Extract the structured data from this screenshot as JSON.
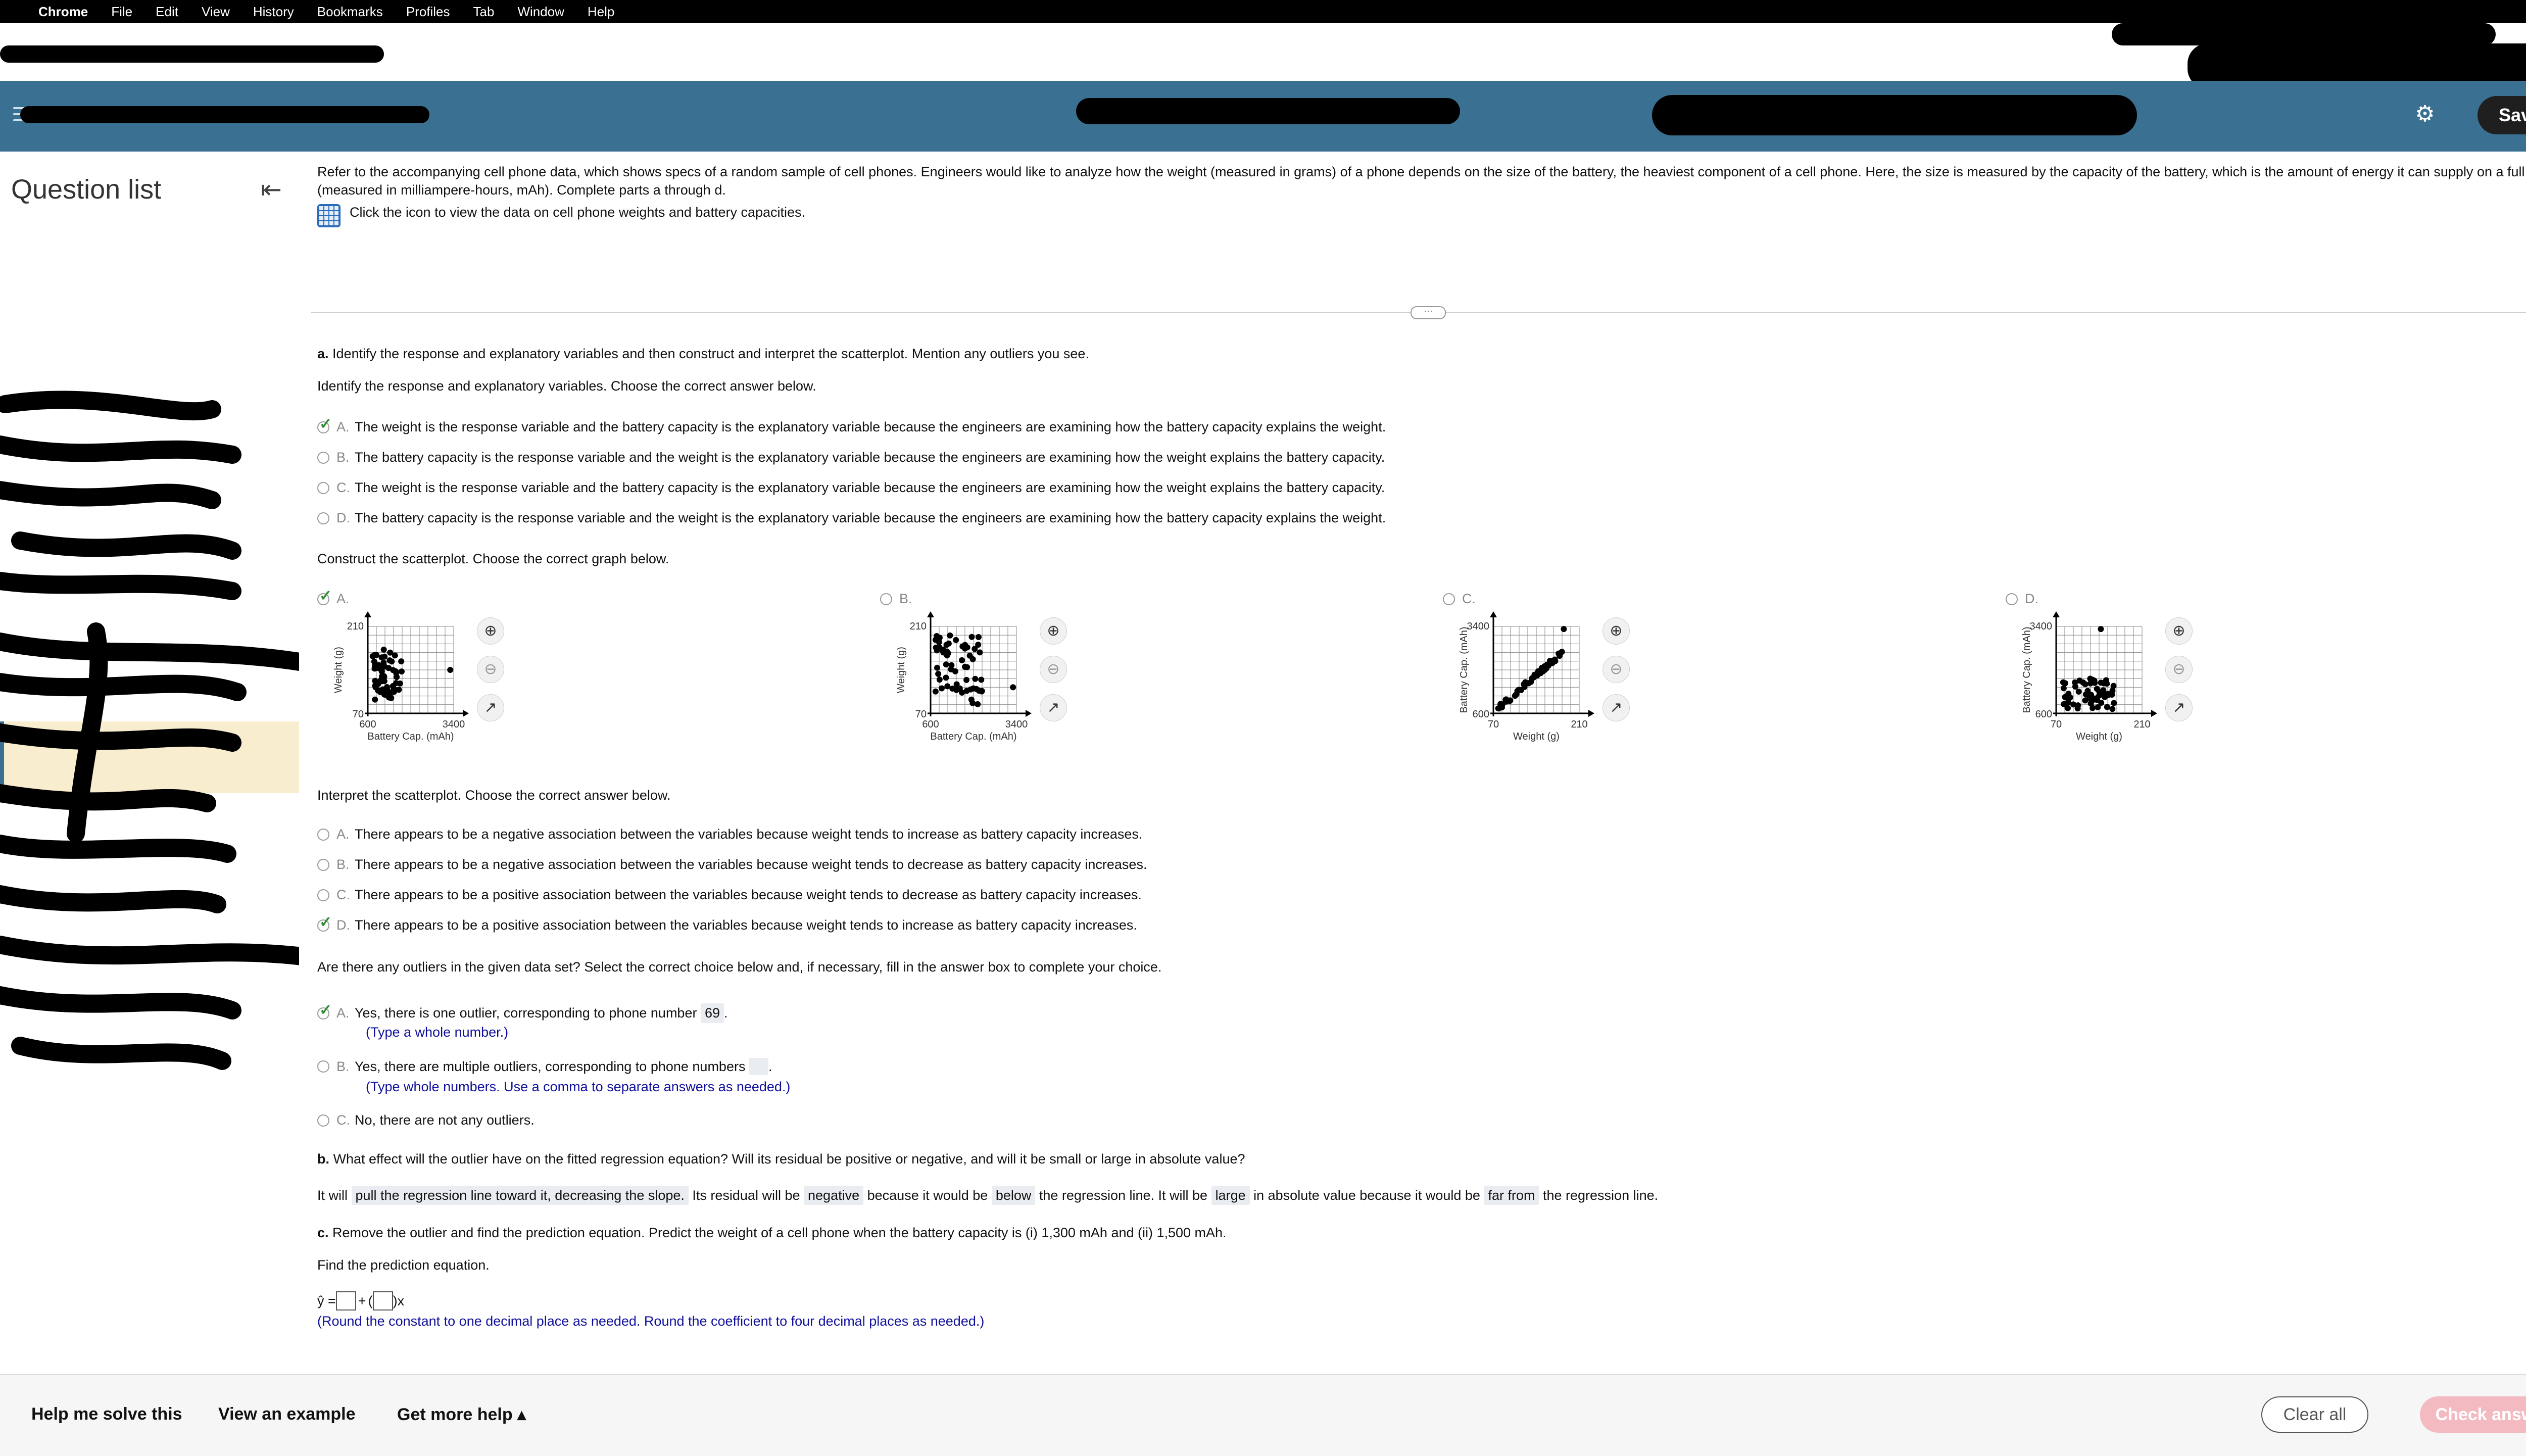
{
  "menubar": {
    "items": [
      "Chrome",
      "File",
      "Edit",
      "View",
      "History",
      "Bookmarks",
      "Profiles",
      "Tab",
      "Window",
      "Help"
    ]
  },
  "header": {
    "save_label": "Save"
  },
  "sidebar": {
    "title": "Question list"
  },
  "intro": {
    "text": "Refer to the accompanying cell phone data, which shows specs of a random sample of cell phones. Engineers would like to analyze how the weight (measured in grams) of a phone depends on the size of the battery, the heaviest component of a cell phone. Here, the size is measured by the capacity of the battery, which is the amount of energy it can supply on a full charge (measured in milliampere-hours, mAh). Complete parts a through d.",
    "data_link": "Click the icon to view the data on cell phone weights and battery capacities."
  },
  "part_a": {
    "label": "a.",
    "prompt": "Identify the response and explanatory variables and then construct and interpret the scatterplot. Mention any outliers you see.",
    "q1": "Identify the response and explanatory variables. Choose the correct answer below.",
    "q1_options": [
      {
        "letter": "A.",
        "text": "The weight is the response variable and the battery capacity is the explanatory variable because the engineers are examining how the battery capacity explains the weight."
      },
      {
        "letter": "B.",
        "text": "The battery capacity is the response variable and the weight is the explanatory variable because the engineers are examining how the weight explains the battery capacity."
      },
      {
        "letter": "C.",
        "text": "The weight is the response variable and the battery capacity is the explanatory variable because the engineers are examining how the weight explains the battery capacity."
      },
      {
        "letter": "D.",
        "text": "The battery capacity is the response variable and the weight is the explanatory variable because the engineers are examining how the battery capacity explains the weight."
      }
    ],
    "q2": "Construct the scatterplot. Choose the correct graph below.",
    "graphs": [
      {
        "letter": "A.",
        "ylabel": "Weight (g)",
        "xlabel": "Battery Cap. (mAh)",
        "ytop": "210",
        "ybot": "70",
        "xleft": "600",
        "xright": "3400"
      },
      {
        "letter": "B.",
        "ylabel": "Weight (g)",
        "xlabel": "Battery Cap. (mAh)",
        "ytop": "210",
        "ybot": "70",
        "xleft": "600",
        "xright": "3400"
      },
      {
        "letter": "C.",
        "ylabel": "Battery Cap. (mAh)",
        "xlabel": "Weight (g)",
        "ytop": "3400",
        "ybot": "600",
        "xleft": "70",
        "xright": "210"
      },
      {
        "letter": "D.",
        "ylabel": "Battery Cap. (mAh)",
        "xlabel": "Weight (g)",
        "ytop": "3400",
        "ybot": "600",
        "xleft": "70",
        "xright": "210"
      }
    ],
    "q3": "Interpret the scatterplot. Choose the correct answer below.",
    "q3_options": [
      {
        "letter": "A.",
        "text": "There appears to be a negative association between the variables because weight tends to increase as battery capacity increases."
      },
      {
        "letter": "B.",
        "text": "There appears to be a negative association between the variables because weight tends to decrease as battery capacity increases."
      },
      {
        "letter": "C.",
        "text": "There appears to be a positive association between the variables because weight tends to decrease as battery capacity increases."
      },
      {
        "letter": "D.",
        "text": "There appears to be a positive association between the variables because weight tends to increase as battery capacity increases."
      }
    ],
    "q4": "Are there any outliers in the given data set? Select the correct choice below and, if necessary, fill in the answer box to complete your choice.",
    "q4_a": {
      "letter": "A.",
      "text": "Yes, there is one outlier, corresponding to phone number",
      "value": "69",
      "hint": "(Type a whole number.)"
    },
    "q4_b": {
      "letter": "B.",
      "text": "Yes, there are multiple outliers, corresponding to phone numbers",
      "hint": "(Type whole numbers. Use a comma to separate answers as needed.)"
    },
    "q4_c": {
      "letter": "C.",
      "text": "No, there are not any outliers."
    }
  },
  "part_b": {
    "label": "b.",
    "prompt": "What effect will the outlier have on the fitted regression equation? Will its residual be positive or negative, and will it be small or large in absolute value?",
    "s1": "It will",
    "a1": "pull the regression line toward it, decreasing the slope.",
    "s2": "Its residual will be",
    "a2": "negative",
    "s3": "because it would be",
    "a3": "below",
    "s4": "the regression line. It will be",
    "a4": "large",
    "s5": "in absolute value because it would be",
    "a5": "far from",
    "s6": "the regression line."
  },
  "part_c": {
    "label": "c.",
    "prompt": "Remove the outlier and find the prediction equation. Predict the weight of a cell phone when the battery capacity is (i) 1,300 mAh and (ii) 1,500 mAh.",
    "find": "Find the prediction equation.",
    "yhat": "ŷ =",
    "plus": "+",
    "open": "(",
    "close": ")",
    "x": "x",
    "hint": "(Round the constant to one decimal place as needed. Round the coefficient to four decimal places as needed.)"
  },
  "bottom": {
    "help_solve": "Help me solve this",
    "view_example": "View an example",
    "more_help": "Get more help ▴",
    "clear_all": "Clear all",
    "check_answer": "Check answer"
  },
  "colors": {
    "header_blue": "#3a7091",
    "check_green": "#2f8a2f",
    "hint_blue": "#10109c",
    "check_answer_pink": "#f3bac2"
  }
}
